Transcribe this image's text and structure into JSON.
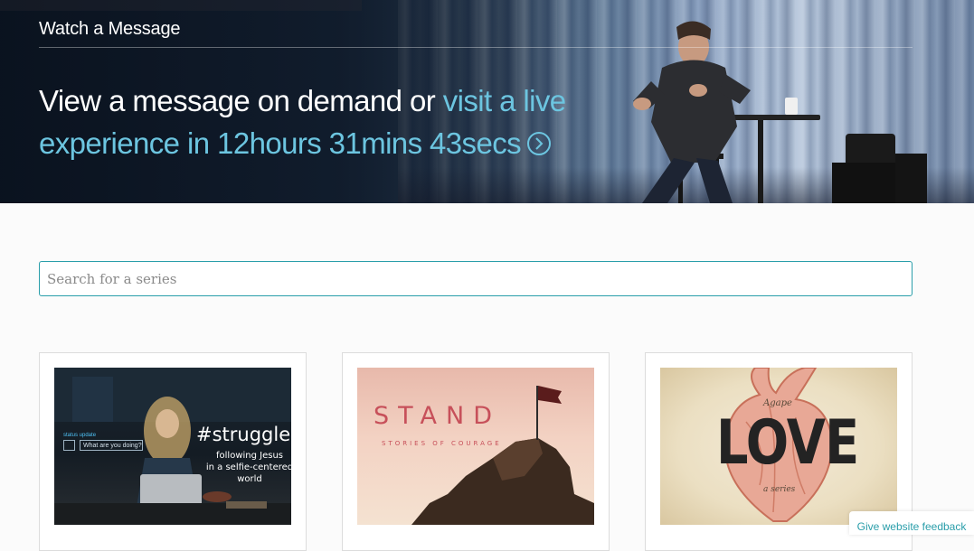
{
  "hero": {
    "title": "Watch a Message",
    "headline_plain": "View a message on demand or ",
    "headline_link": "visit a live experience in 12hours 31mins 43secs"
  },
  "search": {
    "placeholder": "Search for a series",
    "value": ""
  },
  "series": [
    {
      "title": "#struggles",
      "subtitle_line1": "following Jesus",
      "subtitle_line2": "in a selfie-centered world",
      "status_label": "status update",
      "status_placeholder": "What are you doing?"
    },
    {
      "title": "STAND",
      "subtitle": "STORIES OF COURAGE"
    },
    {
      "title": "LOVE",
      "top_word": "Agape",
      "bottom_word": "a series"
    }
  ],
  "feedback": {
    "label": "Give website feedback"
  },
  "colors": {
    "accent": "#2a9eaa",
    "live_link": "#6cc5e0",
    "stand_red": "#c7505a"
  },
  "icons": {
    "live_link": "chevron-right-circle-icon"
  }
}
